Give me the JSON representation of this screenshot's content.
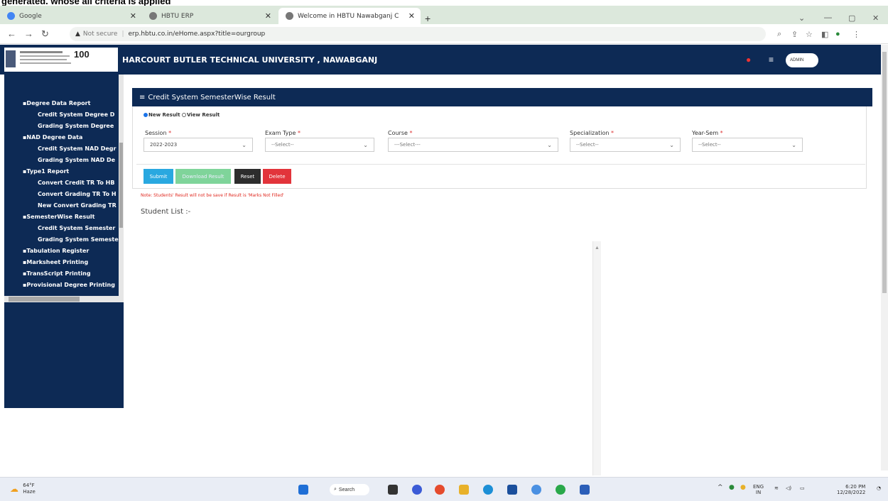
{
  "browser": {
    "tabs": [
      {
        "title": "Google"
      },
      {
        "title": "HBTU ERP"
      },
      {
        "title": "Welcome in HBTU Nawabganj C"
      }
    ],
    "url_warning": "Not secure",
    "url": "erp.hbtu.co.in/eHome.aspx?title=ourgroup"
  },
  "header": {
    "university": "HARCOURT BUTLER TECHNICAL UNIVERSITY , NAWABGANJ",
    "logo_badge": "100",
    "user": "ADMIN"
  },
  "sidebar": {
    "items": [
      {
        "label": "Degree Data Report",
        "level": "cat"
      },
      {
        "label": "Credit System Degree D",
        "level": "sub"
      },
      {
        "label": "Grading System Degree",
        "level": "sub"
      },
      {
        "label": "NAD Degree Data",
        "level": "cat"
      },
      {
        "label": "Credit System NAD Degr",
        "level": "sub"
      },
      {
        "label": "Grading System NAD De",
        "level": "sub"
      },
      {
        "label": "Type1 Report",
        "level": "cat"
      },
      {
        "label": "Convert Credit TR To HB",
        "level": "sub"
      },
      {
        "label": "Convert Grading TR To H",
        "level": "sub"
      },
      {
        "label": "New Convert Grading TR",
        "level": "sub"
      },
      {
        "label": "SemesterWise Result",
        "level": "cat"
      },
      {
        "label": "Credit System Semester",
        "level": "sub"
      },
      {
        "label": "Grading System Semeste",
        "level": "sub"
      },
      {
        "label": "Tabulation Register",
        "level": "cat"
      },
      {
        "label": "Marksheet Printing",
        "level": "cat"
      },
      {
        "label": "TransScript Printing",
        "level": "cat"
      },
      {
        "label": "Provisional Degree Printing",
        "level": "cat"
      }
    ]
  },
  "panel": {
    "title": "Credit System SemesterWise Result",
    "radio_new": "New Result",
    "radio_view": "View Result",
    "selected_radio": "New Result",
    "fields": [
      {
        "label": "Session",
        "value": "2022-2023"
      },
      {
        "label": "Exam Type",
        "value": "--Select--"
      },
      {
        "label": "Course",
        "value": "---Select---"
      },
      {
        "label": "Specialization",
        "value": "--Select--"
      },
      {
        "label": "Year-Sem",
        "value": "--Select--"
      }
    ],
    "buttons": {
      "submit": "Submit",
      "download": "Download Result",
      "reset": "Reset",
      "delete": "Delete"
    },
    "colors": {
      "submit": "#29a8e0",
      "download": "#7fd49a",
      "reset": "#2d2d2d",
      "delete": "#e2343b",
      "header": "#0d2a55"
    },
    "note": "Note: Students' Result will not be save if Result is 'Marks Not Filled'",
    "student_list": "Student List :-"
  },
  "taskbar": {
    "temp": "64°F",
    "weather": "Haze",
    "search": "Search",
    "lang1": "ENG",
    "lang2": "IN",
    "time": "6:20 PM",
    "date": "12/28/2022"
  }
}
